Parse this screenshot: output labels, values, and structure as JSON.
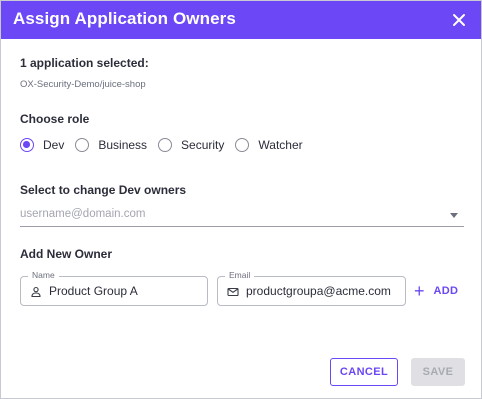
{
  "dialog": {
    "title": "Assign Application Owners",
    "close_icon": "close-icon",
    "selection_count_label": "1 application selected:",
    "selected_app": "OX-Security-Demo/juice-shop"
  },
  "role": {
    "label": "Choose role",
    "options": [
      {
        "label": "Dev",
        "checked": true
      },
      {
        "label": "Business",
        "checked": false
      },
      {
        "label": "Security",
        "checked": false
      },
      {
        "label": "Watcher",
        "checked": false
      }
    ]
  },
  "owners_select": {
    "label": "Select to change Dev owners",
    "placeholder": "username@domain.com"
  },
  "new_owner": {
    "label": "Add New Owner",
    "name_field": {
      "legend": "Name",
      "value": "Product Group A",
      "icon": "person-icon"
    },
    "email_field": {
      "legend": "Email",
      "value": "productgroupa@acme.com",
      "icon": "mail-icon"
    },
    "add_label": "ADD",
    "add_icon": "+"
  },
  "actions": {
    "cancel_label": "CANCEL",
    "save_label": "SAVE"
  },
  "colors": {
    "accent": "#6b47f5",
    "header_bg": "#6b47f5",
    "disabled_bg": "#e0e0e4"
  }
}
